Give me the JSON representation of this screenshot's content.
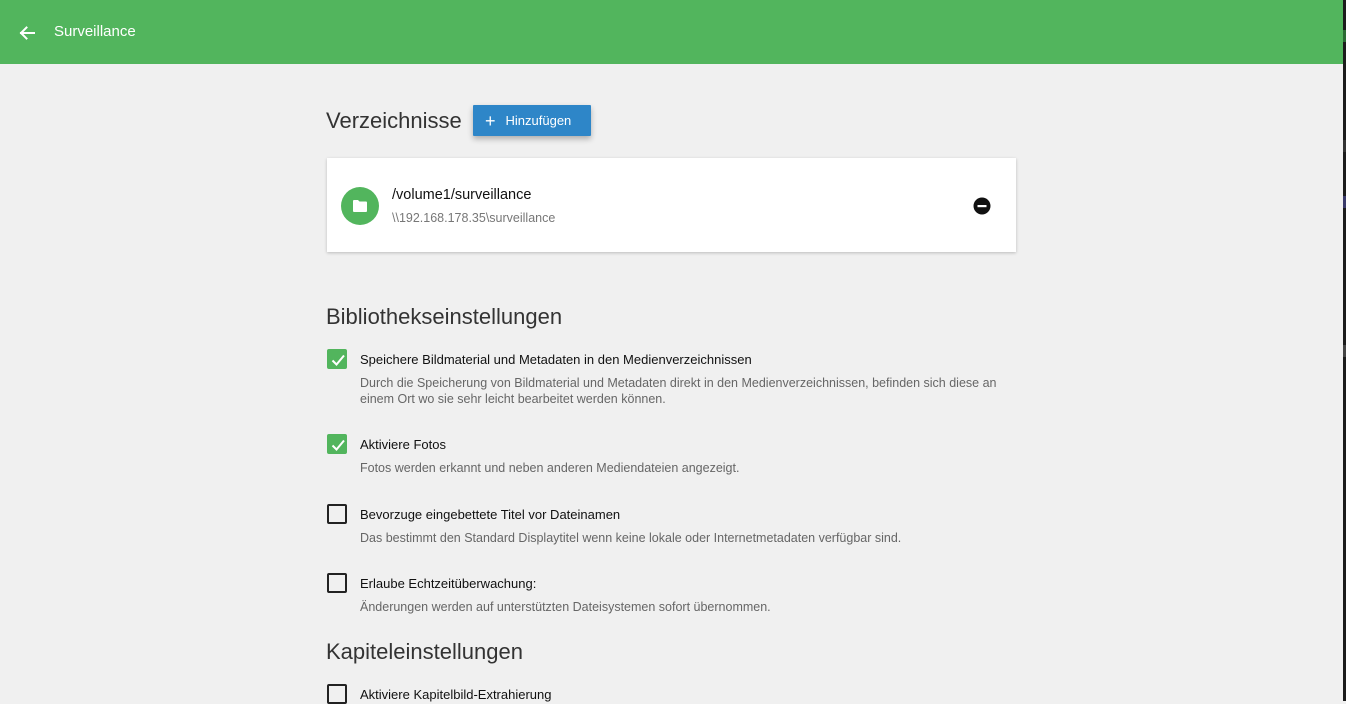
{
  "header": {
    "title": "Surveillance",
    "back_icon": "arrow-left-icon",
    "background_color": "#52b55d"
  },
  "directories": {
    "title": "Verzeichnisse",
    "add_button_label": "Hinzufügen",
    "add_button_color": "#2e86c8",
    "items": [
      {
        "path": "/volume1/surveillance",
        "share": "\\\\192.168.178.35\\surveillance",
        "icon": "folder-icon",
        "action_icon": "remove-circle-icon"
      }
    ]
  },
  "library_settings": {
    "title": "Bibliothekseinstellungen",
    "options": [
      {
        "label": "Speichere Bildmaterial und Metadaten in den Medienverzeichnissen",
        "description": "Durch die Speicherung von Bildmaterial und Metadaten direkt in den Medienverzeichnissen, befinden sich diese an einem Ort wo sie sehr leicht bearbeitet werden können.",
        "checked": true
      },
      {
        "label": "Aktiviere Fotos",
        "description": "Fotos werden erkannt und neben anderen Mediendateien angezeigt.",
        "checked": true
      },
      {
        "label": "Bevorzuge eingebettete Titel vor Dateinamen",
        "description": "Das bestimmt den Standard Displaytitel wenn keine lokale oder Internetmetadaten verfügbar sind.",
        "checked": false
      },
      {
        "label": "Erlaube Echtzeitüberwachung:",
        "description": "Änderungen werden auf unterstützten Dateisystemen sofort übernommen.",
        "checked": false
      }
    ]
  },
  "chapter_settings": {
    "title": "Kapiteleinstellungen",
    "options": [
      {
        "label": "Aktiviere Kapitelbild-Extrahierung",
        "checked": false
      }
    ]
  }
}
